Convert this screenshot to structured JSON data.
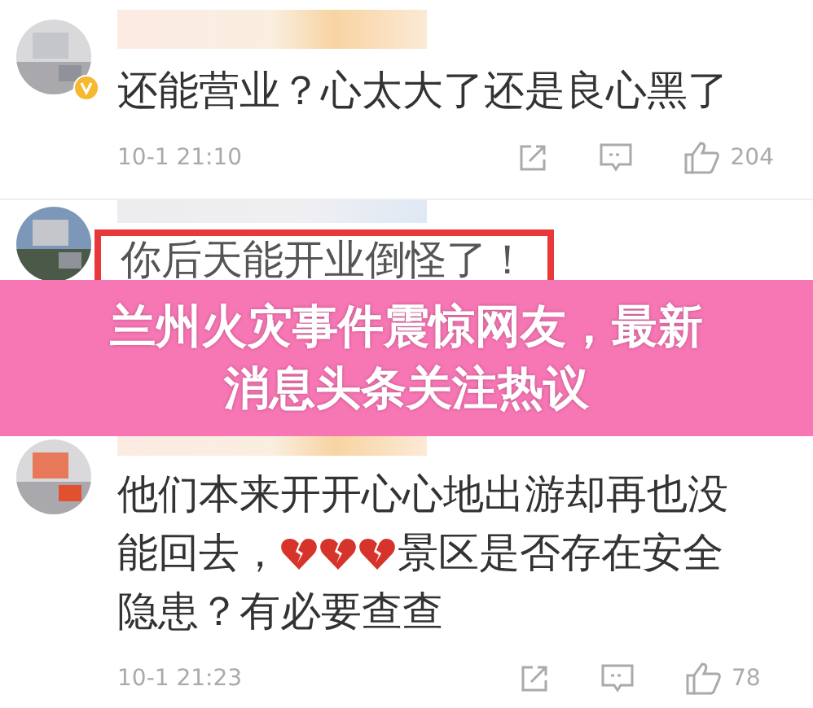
{
  "comments": [
    {
      "avatar": {
        "verified": true
      },
      "highlighted": false,
      "lines": [
        [
          {
            "kind": "text",
            "text": "还能营业？心太大了还是良心黑了"
          }
        ]
      ],
      "time": "10-1 21:10",
      "likes": "204"
    },
    {
      "avatar": {
        "verified": false
      },
      "highlighted": true,
      "lines": [
        [
          {
            "kind": "text",
            "text": "你后天能开业倒怪了！"
          }
        ]
      ]
    },
    {
      "avatar": {
        "verified": false
      },
      "highlighted": false,
      "lines": [
        [
          {
            "kind": "text",
            "text": "他们本来开开心心地出游却再也没"
          }
        ],
        [
          {
            "kind": "text",
            "text": "能回去，"
          },
          {
            "kind": "broken-heart"
          },
          {
            "kind": "broken-heart"
          },
          {
            "kind": "broken-heart"
          },
          {
            "kind": "text",
            "text": "景区是否存在安全"
          }
        ],
        [
          {
            "kind": "text",
            "text": "隐患？有必要查查"
          }
        ]
      ],
      "time": "10-1 21:23",
      "likes": "78"
    }
  ],
  "banner": {
    "lines": [
      "兰州火灾事件震惊网友，最新",
      "消息头条关注热议"
    ]
  }
}
